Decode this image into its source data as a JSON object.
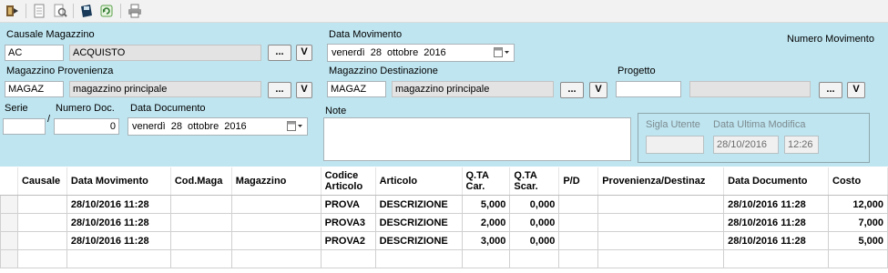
{
  "toolbar": {
    "icons": [
      "exit-icon",
      "new-document-icon",
      "search-document-icon",
      "save-icon",
      "refresh-icon",
      "print-icon"
    ]
  },
  "form": {
    "causale_label": "Causale Magazzino",
    "causale_code": "AC",
    "causale_desc": "ACQUISTO",
    "browse_label": "...",
    "v_label": "V",
    "data_movimento_label": "Data Movimento",
    "data_movimento": {
      "weekday": "venerdì",
      "day": "28",
      "month": "ottobre",
      "year": "2016"
    },
    "numero_movimento_label": "Numero Movimento",
    "mag_prov_label": "Magazzino Provenienza",
    "mag_prov_code": "MAGAZ",
    "mag_prov_desc": "magazzino principale",
    "mag_dest_label": "Magazzino Destinazione",
    "mag_dest_code": "MAGAZ",
    "mag_dest_desc": "magazzino principale",
    "progetto_label": "Progetto",
    "progetto_code": "",
    "progetto_desc": "",
    "serie_label": "Serie",
    "serie_value": "",
    "slash": "/",
    "numero_doc_label": "Numero Doc.",
    "numero_doc_value": "0",
    "data_documento_label": "Data Documento",
    "data_documento": {
      "weekday": "venerdì",
      "day": "28",
      "month": "ottobre",
      "year": "2016"
    },
    "note_label": "Note",
    "note_value": "",
    "sigla_utente_label": "Sigla Utente",
    "sigla_utente_value": "",
    "data_ultima_modifica_label": "Data Ultima Modifica",
    "data_ultima_modifica_date": "28/10/2016",
    "data_ultima_modifica_time": "12:26"
  },
  "grid": {
    "headers": [
      "Causale",
      "Data Movimento",
      "Cod.Maga",
      "Magazzino",
      "Codice Articolo",
      "Articolo",
      "Q.TA Car.",
      "Q.TA Scar.",
      "P/D",
      "Provenienza/Destinaz",
      "Data Documento",
      "Costo"
    ],
    "rows": [
      [
        "",
        "28/10/2016 11:28",
        "",
        "",
        "PROVA",
        "DESCRIZIONE",
        "5,000",
        "0,000",
        "",
        "",
        "28/10/2016 11:28",
        "12,000"
      ],
      [
        "",
        "28/10/2016 11:28",
        "",
        "",
        "PROVA3",
        "DESCRIZIONE",
        "2,000",
        "0,000",
        "",
        "",
        "28/10/2016 11:28",
        "7,000"
      ],
      [
        "",
        "28/10/2016 11:28",
        "",
        "",
        "PROVA2",
        "DESCRIZIONE",
        "3,000",
        "0,000",
        "",
        "",
        "28/10/2016 11:28",
        "5,000"
      ],
      [
        "",
        "",
        "",
        "",
        "",
        "",
        "",
        "",
        "",
        "",
        "",
        ""
      ]
    ]
  }
}
